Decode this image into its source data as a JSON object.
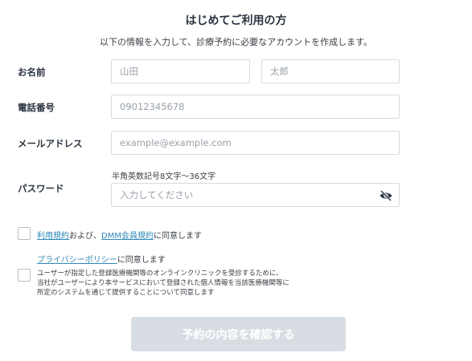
{
  "header": {
    "title": "はじめてご利用の方",
    "subtitle": "以下の情報を入力して、診療予約に必要なアカウントを作成します。"
  },
  "form": {
    "name_label": "お名前",
    "last_name_placeholder": "山田",
    "first_name_placeholder": "太郎",
    "phone_label": "電話番号",
    "phone_placeholder": "09012345678",
    "email_label": "メールアドレス",
    "email_placeholder": "example@example.com",
    "password_label": "パスワード",
    "password_hint": "半角英数記号8文字〜36文字",
    "password_placeholder": "入力してください"
  },
  "agreements": {
    "terms_link": "利用規約",
    "terms_and": "および、",
    "dmm_link": "DMM会員規約",
    "terms_suffix": "に同意します",
    "privacy_link": "プライバシーポリシー",
    "privacy_suffix": "に同意します",
    "info_line1": "ユーザーが指定した登録医療機関等のオンラインクリニックを受診するために、",
    "info_line2": "当社がユーザーにより本サービスにおいて登録された個人情報を当該医療機関等に",
    "info_line3": "所定のシステムを通じて提供することについて同意します"
  },
  "submit": {
    "label": "予約の内容を確認する"
  },
  "colors": {
    "link": "#2f88b8",
    "button_disabled": "#d7dde3"
  }
}
